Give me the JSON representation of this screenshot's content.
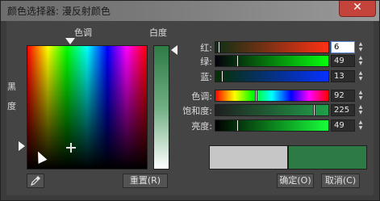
{
  "window": {
    "title": "颜色选择器: 漫反射颜色",
    "close_glyph": "✕"
  },
  "labels": {
    "hue": "色调",
    "whiteness": "白度",
    "blackness_1": "黑",
    "blackness_2": "度"
  },
  "sliders": [
    {
      "label": "红:",
      "value": "6",
      "fraction": 0.02
    },
    {
      "label": "绿:",
      "value": "49",
      "fraction": 0.19
    },
    {
      "label": "蓝:",
      "value": "13",
      "fraction": 0.05
    },
    {
      "label": "色调:",
      "value": "92",
      "fraction": 0.36
    },
    {
      "label": "饱和度:",
      "value": "225",
      "fraction": 0.88
    },
    {
      "label": "亮度:",
      "value": "49",
      "fraction": 0.19
    }
  ],
  "buttons": {
    "reset": "重置(R)",
    "ok": "确定(O)",
    "cancel": "取消(C)"
  },
  "swatches": {
    "original": "#c6c6c6",
    "current": "#2e7a45"
  },
  "colors": {
    "accent": "#2e7a45"
  }
}
